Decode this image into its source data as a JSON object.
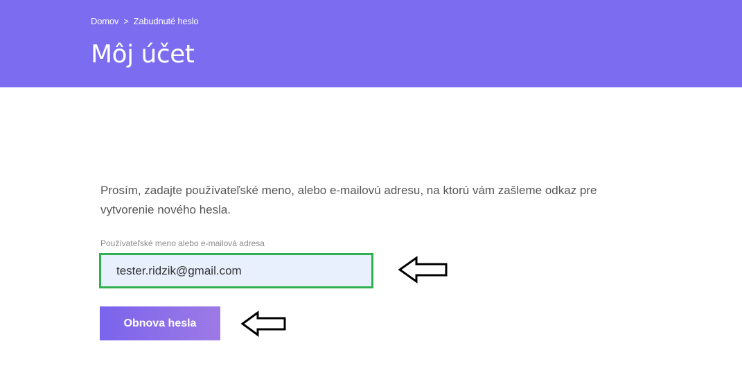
{
  "breadcrumb": {
    "home": "Domov",
    "separator": ">",
    "current": "Zabudnuté heslo"
  },
  "page": {
    "title": "Môj účet"
  },
  "form": {
    "intro": "Prosím, zadajte používateľské meno, alebo e-mailovú adresu, na ktorú vám zašleme odkaz pre vytvorenie nového hesla.",
    "field_label": "Používateľské meno alebo e-mailová adresa",
    "field_value": "tester.ridzik@gmail.com",
    "submit_label": "Obnova hesla"
  },
  "annotations": {
    "arrow_icon": "left-arrow-outline-icon",
    "highlight_color": "#2fb14f"
  },
  "colors": {
    "header_bg": "#7b6cf0",
    "button_bg": "#7a64ec",
    "input_bg": "#e8f0fe"
  }
}
